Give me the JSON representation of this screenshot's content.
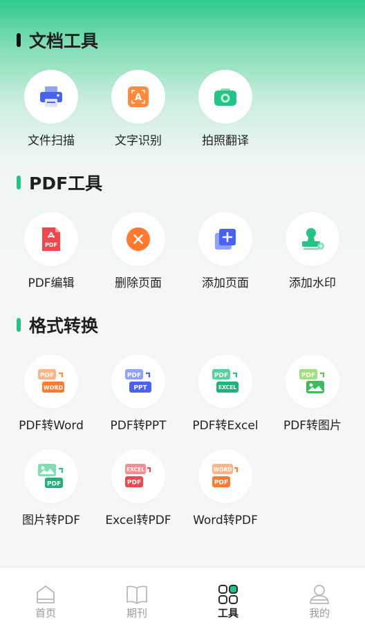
{
  "colors": {
    "accent_green": "#23c483",
    "tab_inactive": "#9a9a9a",
    "tab_active": "#222222"
  },
  "sections": {
    "doc_tools": {
      "title": "文档工具",
      "items": [
        {
          "label": "文件扫描",
          "icon": "printer-icon"
        },
        {
          "label": "文字识别",
          "icon": "ocr-icon"
        },
        {
          "label": "拍照翻译",
          "icon": "camera-icon"
        }
      ]
    },
    "pdf_tools": {
      "title": "PDF工具",
      "items": [
        {
          "label": "PDF编辑",
          "icon": "pdf-file-icon"
        },
        {
          "label": "删除页面",
          "icon": "delete-page-icon"
        },
        {
          "label": "添加页面",
          "icon": "add-page-icon"
        },
        {
          "label": "添加水印",
          "icon": "watermark-stamp-icon"
        }
      ]
    },
    "format_convert": {
      "title": "格式转换",
      "items": [
        {
          "label": "PDF转Word",
          "icon": "pdf-to-word-icon",
          "top": "PDF",
          "bottom": "WORD"
        },
        {
          "label": "PDF转PPT",
          "icon": "pdf-to-ppt-icon",
          "top": "PDF",
          "bottom": "PPT"
        },
        {
          "label": "PDF转Excel",
          "icon": "pdf-to-excel-icon",
          "top": "PDF",
          "bottom": "EXCEL"
        },
        {
          "label": "PDF转图片",
          "icon": "pdf-to-image-icon",
          "top": "PDF"
        },
        {
          "label": "图片转PDF",
          "icon": "image-to-pdf-icon",
          "bottom": "PDF"
        },
        {
          "label": "Excel转PDF",
          "icon": "excel-to-pdf-icon",
          "top": "EXCEL",
          "bottom": "PDF"
        },
        {
          "label": "Word转PDF",
          "icon": "word-to-pdf-icon",
          "top": "WORD",
          "bottom": "PDF"
        }
      ]
    }
  },
  "tabbar": {
    "items": [
      {
        "label": "首页",
        "icon": "home-icon",
        "active": false
      },
      {
        "label": "期刊",
        "icon": "book-icon",
        "active": false
      },
      {
        "label": "工具",
        "icon": "grid-icon",
        "active": true
      },
      {
        "label": "我的",
        "icon": "user-icon",
        "active": false
      }
    ]
  }
}
